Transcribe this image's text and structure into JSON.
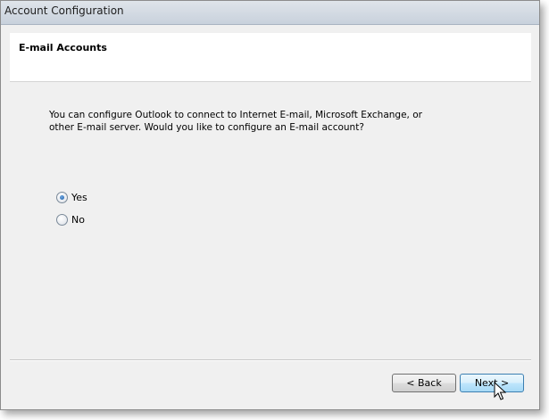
{
  "window": {
    "title": "Account Configuration"
  },
  "header": {
    "title": "E-mail Accounts"
  },
  "content": {
    "description": "You can configure Outlook to connect to Internet E-mail, Microsoft Exchange, or other E-mail server. Would you like to configure an E-mail account?",
    "options": [
      {
        "label": "Yes",
        "selected": true
      },
      {
        "label": "No",
        "selected": false
      }
    ]
  },
  "footer": {
    "back_label": "< Back",
    "next_label": "Next >"
  },
  "icons": {
    "cursor": "mouse-pointer-icon"
  }
}
